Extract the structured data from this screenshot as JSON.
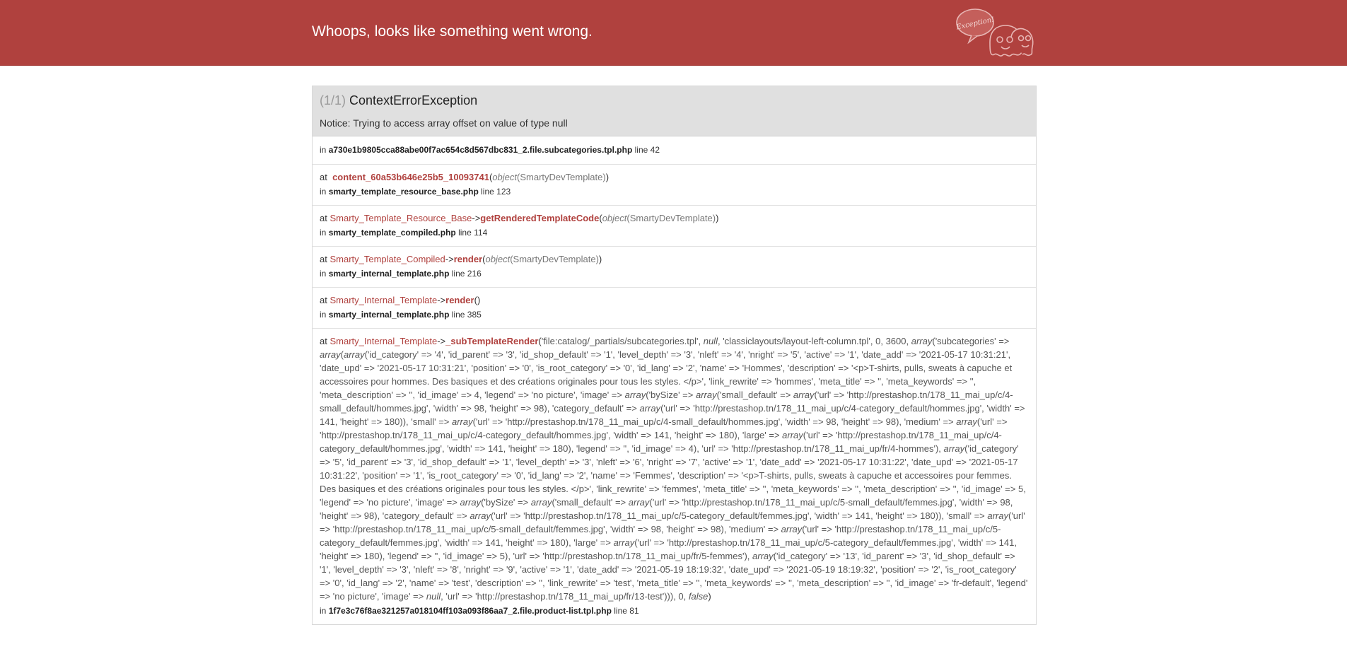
{
  "header": {
    "title": "Whoops, looks like something went wrong.",
    "ghost_label": "Exception!"
  },
  "exception": {
    "count": "(1/1)",
    "class": "ContextErrorException",
    "message": "Notice: Trying to access array offset on value of type null",
    "in_prefix": "in",
    "file": "a730e1b9805cca88abe00f7ac654c8d567dbc831_2.file.subcategories.tpl.php",
    "line": "line 42"
  },
  "trace": [
    {
      "at": "at",
      "class": "",
      "arrow": "",
      "fn": "content_60a53b646e25b5_10093741",
      "open": "(",
      "args_obj": "object",
      "args_type": "(SmartyDevTemplate)",
      "close": ")",
      "in": "in",
      "file": "smarty_template_resource_base.php",
      "line": "line 123"
    },
    {
      "at": "at",
      "class": "Smarty_Template_Resource_Base",
      "arrow": "->",
      "fn": "getRenderedTemplateCode",
      "open": "(",
      "args_obj": "object",
      "args_type": "(SmartyDevTemplate)",
      "close": ")",
      "in": "in",
      "file": "smarty_template_compiled.php",
      "line": "line 114"
    },
    {
      "at": "at",
      "class": "Smarty_Template_Compiled",
      "arrow": "->",
      "fn": "render",
      "open": "(",
      "args_obj": "object",
      "args_type": "(SmartyDevTemplate)",
      "close": ")",
      "in": "in",
      "file": "smarty_internal_template.php",
      "line": "line 216"
    },
    {
      "at": "at",
      "class": "Smarty_Internal_Template",
      "arrow": "->",
      "fn": "render",
      "open": "(",
      "args_obj": "",
      "args_type": "",
      "close": ")",
      "in": "in",
      "file": "smarty_internal_template.php",
      "line": "line 385"
    }
  ],
  "big_trace": {
    "at": "at",
    "class": "Smarty_Internal_Template",
    "arrow": "->",
    "fn": "_subTemplateRender",
    "open": "(",
    "close": ")",
    "in": "in",
    "file": "1f7e3c76f8ae321257a018104ff103a093f86aa7_2.file.product-list.tpl.php",
    "line": "line 81",
    "args": [
      {
        "t": "'file:catalog/_partials/subcategories.tpl', "
      },
      {
        "t": "null",
        "i": true
      },
      {
        "t": ", 'classiclayouts/layout-left-column.tpl', 0, 3600, "
      },
      {
        "t": "array",
        "i": true
      },
      {
        "t": "('subcategories' => "
      },
      {
        "t": "array",
        "i": true
      },
      {
        "t": "("
      },
      {
        "t": "array",
        "i": true
      },
      {
        "t": "('id_category' => '4', 'id_parent' => '3', 'id_shop_default' => '1', 'level_depth' => '3', 'nleft' => '4', 'nright' => '5', 'active' => '1', 'date_add' => '2021-05-17 10:31:21', 'date_upd' => '2021-05-17 10:31:21', 'position' => '0', 'is_root_category' => '0', 'id_lang' => '2', 'name' => 'Hommes', 'description' => '<p>T-shirts, pulls, sweats à capuche et accessoires pour hommes. Des basiques et des créations originales pour tous les styles. </p>', 'link_rewrite' => 'hommes', 'meta_title' => '', 'meta_keywords' => '', 'meta_description' => '', 'id_image' => 4, 'legend' => 'no picture', 'image' => "
      },
      {
        "t": "array",
        "i": true
      },
      {
        "t": "('bySize' => "
      },
      {
        "t": "array",
        "i": true
      },
      {
        "t": "('small_default' => "
      },
      {
        "t": "array",
        "i": true
      },
      {
        "t": "('url' => 'http://prestashop.tn/178_11_mai_up/c/4-small_default/hommes.jpg', 'width' => 98, 'height' => 98), 'category_default' => "
      },
      {
        "t": "array",
        "i": true
      },
      {
        "t": "('url' => 'http://prestashop.tn/178_11_mai_up/c/4-category_default/hommes.jpg', 'width' => 141, 'height' => 180)), 'small' => "
      },
      {
        "t": "array",
        "i": true
      },
      {
        "t": "('url' => 'http://prestashop.tn/178_11_mai_up/c/4-small_default/hommes.jpg', 'width' => 98, 'height' => 98), 'medium' => "
      },
      {
        "t": "array",
        "i": true
      },
      {
        "t": "('url' => 'http://prestashop.tn/178_11_mai_up/c/4-category_default/hommes.jpg', 'width' => 141, 'height' => 180), 'large' => "
      },
      {
        "t": "array",
        "i": true
      },
      {
        "t": "('url' => 'http://prestashop.tn/178_11_mai_up/c/4-category_default/hommes.jpg', 'width' => 141, 'height' => 180), 'legend' => '', 'id_image' => 4), 'url' => 'http://prestashop.tn/178_11_mai_up/fr/4-hommes'), "
      },
      {
        "t": "array",
        "i": true
      },
      {
        "t": "('id_category' => '5', 'id_parent' => '3', 'id_shop_default' => '1', 'level_depth' => '3', 'nleft' => '6', 'nright' => '7', 'active' => '1', 'date_add' => '2021-05-17 10:31:22', 'date_upd' => '2021-05-17 10:31:22', 'position' => '1', 'is_root_category' => '0', 'id_lang' => '2', 'name' => 'Femmes', 'description' => '<p>T-shirts, pulls, sweats à capuche et accessoires pour femmes. Des basiques et des créations originales pour tous les styles. </p>', 'link_rewrite' => 'femmes', 'meta_title' => '', 'meta_keywords' => '', 'meta_description' => '', 'id_image' => 5, 'legend' => 'no picture', 'image' => "
      },
      {
        "t": "array",
        "i": true
      },
      {
        "t": "('bySize' => "
      },
      {
        "t": "array",
        "i": true
      },
      {
        "t": "('small_default' => "
      },
      {
        "t": "array",
        "i": true
      },
      {
        "t": "('url' => 'http://prestashop.tn/178_11_mai_up/c/5-small_default/femmes.jpg', 'width' => 98, 'height' => 98), 'category_default' => "
      },
      {
        "t": "array",
        "i": true
      },
      {
        "t": "('url' => 'http://prestashop.tn/178_11_mai_up/c/5-category_default/femmes.jpg', 'width' => 141, 'height' => 180)), 'small' => "
      },
      {
        "t": "array",
        "i": true
      },
      {
        "t": "('url' => 'http://prestashop.tn/178_11_mai_up/c/5-small_default/femmes.jpg', 'width' => 98, 'height' => 98), 'medium' => "
      },
      {
        "t": "array",
        "i": true
      },
      {
        "t": "('url' => 'http://prestashop.tn/178_11_mai_up/c/5-category_default/femmes.jpg', 'width' => 141, 'height' => 180), 'large' => "
      },
      {
        "t": "array",
        "i": true
      },
      {
        "t": "('url' => 'http://prestashop.tn/178_11_mai_up/c/5-category_default/femmes.jpg', 'width' => 141, 'height' => 180), 'legend' => '', 'id_image' => 5), 'url' => 'http://prestashop.tn/178_11_mai_up/fr/5-femmes'), "
      },
      {
        "t": "array",
        "i": true
      },
      {
        "t": "('id_category' => '13', 'id_parent' => '3', 'id_shop_default' => '1', 'level_depth' => '3', 'nleft' => '8', 'nright' => '9', 'active' => '1', 'date_add' => '2021-05-19 18:19:32', 'date_upd' => '2021-05-19 18:19:32', 'position' => '2', 'is_root_category' => '0', 'id_lang' => '2', 'name' => 'test', 'description' => '', 'link_rewrite' => 'test', 'meta_title' => '', 'meta_keywords' => '', 'meta_description' => '', 'id_image' => 'fr-default', 'legend' => 'no picture', 'image' => "
      },
      {
        "t": "null",
        "i": true
      },
      {
        "t": ", 'url' => 'http://prestashop.tn/178_11_mai_up/fr/13-test'))), 0, "
      },
      {
        "t": "false",
        "i": true
      }
    ]
  }
}
